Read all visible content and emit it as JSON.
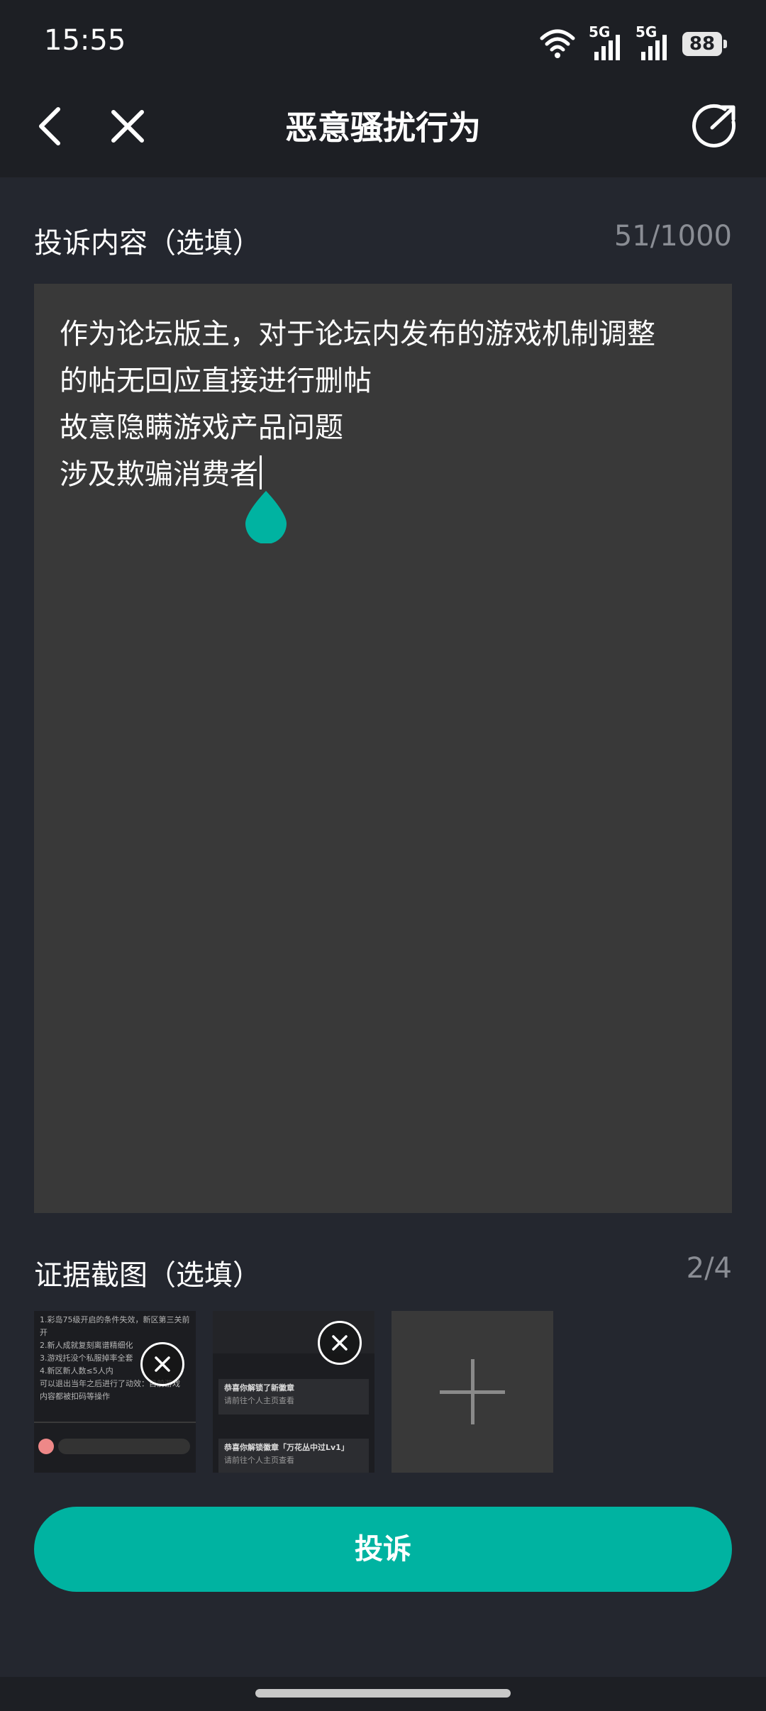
{
  "status_bar": {
    "time": "15:55",
    "signal1_label": "5G",
    "signal2_label": "5G",
    "battery": "88",
    "icons": [
      "wifi-icon",
      "signal-icon",
      "signal-icon",
      "battery-icon"
    ]
  },
  "nav": {
    "title": "恶意骚扰行为",
    "icons": [
      "back-arrow-icon",
      "close-icon",
      "share-icon"
    ]
  },
  "complaint": {
    "label": "投诉内容（选填）",
    "counter": "51/1000",
    "lines": [
      "作为论坛版主，对于论坛内发布的游戏机制调整",
      "的帖无回应直接进行删帖",
      "故意隐瞒游戏产品问题",
      "涉及欺骗消费者"
    ]
  },
  "evidence": {
    "label": "证据截图（选填）",
    "counter": "2/4",
    "thumbnails": [
      {
        "lines": [
          "1.彩岛75级开启的条件失效，新区第三关前",
          "开",
          "2.新人成就复刻离谱精细化",
          "3.游戏托没个私服掉率全套",
          "4.新区新人数≤5人内",
          "可以退出当年之后进行了动效：目前游戏",
          "内容都被扣码等操作"
        ]
      },
      {
        "lines": [
          "恭喜你解锁了新徽章",
          "请前往个人主页查看",
          "恭喜你解锁徽章「万花丛中过Lv1」",
          "请前往个人主页查看"
        ]
      }
    ],
    "add_icon": "plus-icon"
  },
  "submit_label": "投诉",
  "colors": {
    "accent": "#00b3a1",
    "background": "#24272f",
    "header": "#1d1f24",
    "textarea": "#393939",
    "muted": "#8a8d94"
  }
}
